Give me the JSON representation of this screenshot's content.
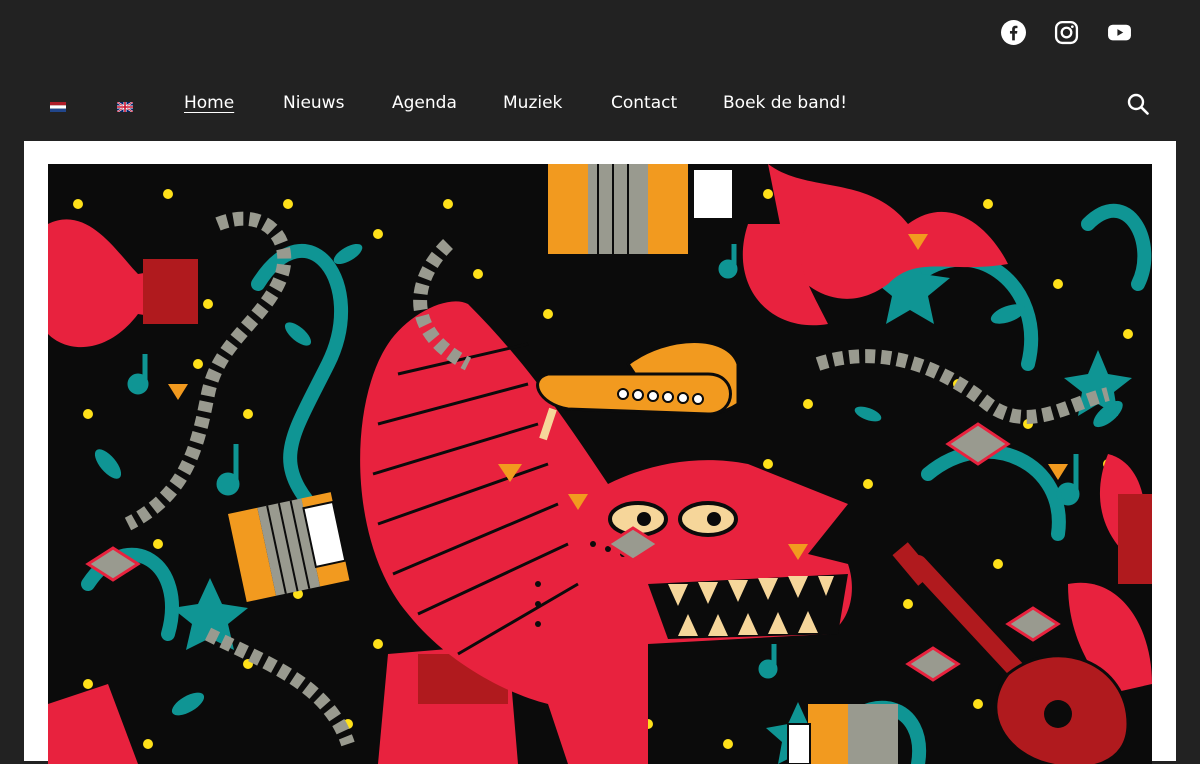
{
  "header": {
    "social": [
      {
        "name": "facebook-icon"
      },
      {
        "name": "instagram-icon"
      },
      {
        "name": "youtube-icon"
      }
    ]
  },
  "nav": {
    "languages": [
      {
        "code": "nl",
        "icon": "dutch-flag-icon"
      },
      {
        "code": "en",
        "icon": "uk-flag-icon"
      }
    ],
    "items": [
      {
        "label": "Home",
        "active": true
      },
      {
        "label": "Nieuws"
      },
      {
        "label": "Agenda"
      },
      {
        "label": "Muziek"
      },
      {
        "label": "Contact"
      },
      {
        "label": "Boek de band!"
      }
    ],
    "search_icon": "search-icon"
  },
  "colors": {
    "background": "#222222",
    "panel": "#ffffff",
    "hero_red": "#e8223e",
    "hero_teal": "#0f9594",
    "hero_orange": "#f29a1f",
    "hero_yellow": "#ffe11a"
  }
}
